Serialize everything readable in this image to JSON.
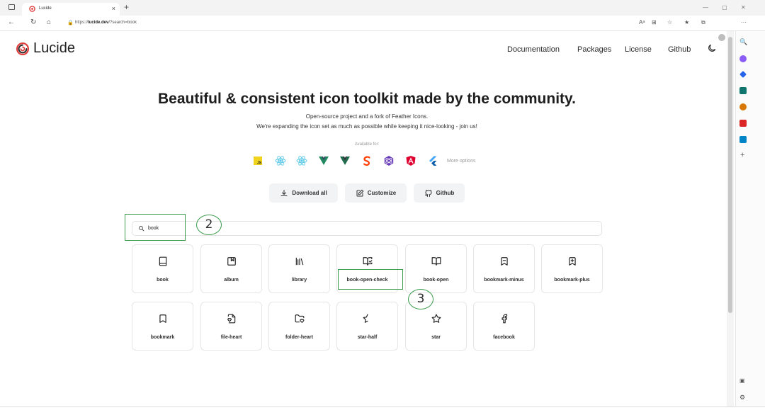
{
  "browser": {
    "tab_title": "Lucide",
    "url_prefix": "https://",
    "url_host": "lucide.dev",
    "url_path": "/?search=book",
    "tab_close": "×",
    "new_tab": "+"
  },
  "site": {
    "logo_text": "Lucide",
    "nav": [
      "Documentation",
      "Packages",
      "License",
      "Github"
    ]
  },
  "hero": {
    "title": "Beautiful & consistent icon toolkit made by the community.",
    "line1": "Open-source project and a fork of Feather Icons.",
    "line2": "We're expanding the icon set as much as possible while keeping it nice-looking - join us!",
    "available_for": "Available for:",
    "more_options": "More options",
    "frameworks": [
      "javascript-icon",
      "react-icon",
      "react-native-icon",
      "vue-icon",
      "vue-next-icon",
      "svelte-icon",
      "preact-icon",
      "angular-icon",
      "flutter-icon"
    ]
  },
  "buttons": {
    "download": "Download all",
    "customize": "Customize",
    "github": "Github"
  },
  "search": {
    "value": "book"
  },
  "annotations": {
    "step2": "2",
    "step3": "3"
  },
  "icons": [
    {
      "name": "book"
    },
    {
      "name": "album"
    },
    {
      "name": "library"
    },
    {
      "name": "book-open-check"
    },
    {
      "name": "book-open"
    },
    {
      "name": "bookmark-minus"
    },
    {
      "name": "bookmark-plus"
    },
    {
      "name": "bookmark"
    },
    {
      "name": "file-heart"
    },
    {
      "name": "folder-heart"
    },
    {
      "name": "star-half"
    },
    {
      "name": "star"
    },
    {
      "name": "facebook"
    }
  ],
  "colors": {
    "brand_red": "#e03a3a",
    "annotation_green": "#3a9b4c"
  }
}
